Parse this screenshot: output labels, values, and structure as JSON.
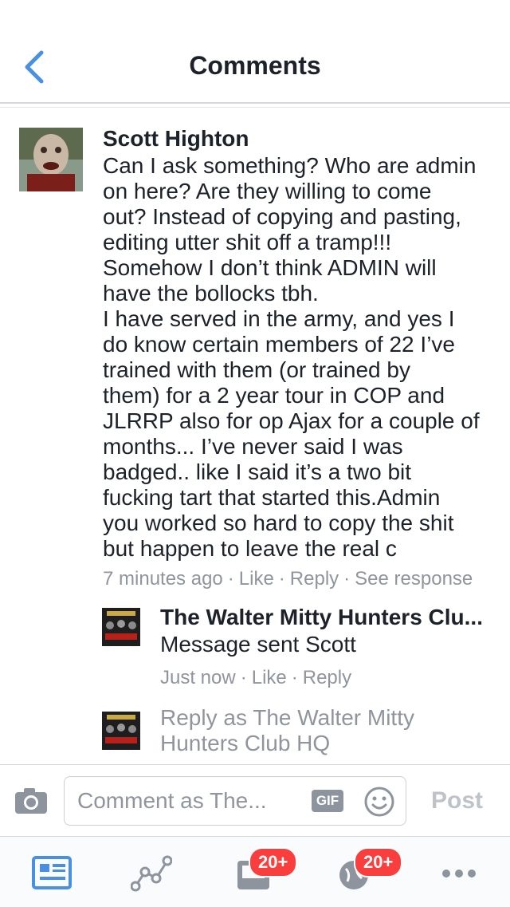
{
  "header": {
    "title": "Comments"
  },
  "comment": {
    "author": "Scott Highton",
    "lines": [
      "Can I ask something? Who are admin",
      "on here? Are they willing to come",
      "out? Instead of copying and pasting,",
      "editing utter shit off a tramp!!!",
      "Somehow I don’t think ADMIN will",
      "have the bollocks tbh.",
      "I have served in the army, and yes I",
      "do know certain members of 22 I’ve",
      "trained with them (or trained by",
      "them) for a 2 year tour in COP and",
      "JLRRP also for op Ajax for a couple of",
      "months... I’ve never said I was",
      "badged.. like I said it’s a two bit",
      "fucking tart that started this.Admin",
      "you worked so hard to copy the shit",
      "but happen to leave the real c"
    ],
    "time": "7 minutes ago",
    "like": "Like",
    "reply": "Reply",
    "see_response": "See response"
  },
  "reply": {
    "author": "The Walter Mitty Hunters Clu...",
    "text": "Message sent Scott",
    "time": "Just now",
    "like": "Like",
    "reply": "Reply"
  },
  "reply_as": {
    "lines": [
      "Reply as The Walter Mitty",
      "Hunters Club HQ"
    ]
  },
  "composer": {
    "placeholder": "Comment as The...",
    "gif": "GIF",
    "post": "Post"
  },
  "tabbar": {
    "badge_1": "20+",
    "badge_2": "20+"
  },
  "colors": {
    "accent": "#4a90e2",
    "badge": "#fa3e3e",
    "muted": "#90949c"
  }
}
